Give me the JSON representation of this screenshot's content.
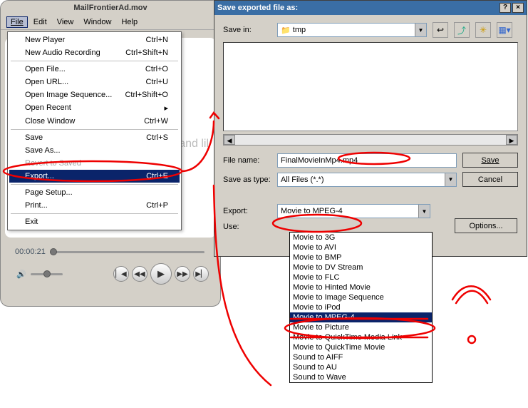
{
  "player": {
    "title": "MailFrontierAd.mov",
    "menubar": [
      "File",
      "Edit",
      "View",
      "Window",
      "Help"
    ],
    "file_menu": {
      "groups": [
        [
          {
            "label": "New Player",
            "shortcut": "Ctrl+N",
            "disabled": false
          },
          {
            "label": "New Audio Recording",
            "shortcut": "Ctrl+Shift+N",
            "disabled": false
          }
        ],
        [
          {
            "label": "Open File...",
            "shortcut": "Ctrl+O",
            "disabled": false
          },
          {
            "label": "Open URL...",
            "shortcut": "Ctrl+U",
            "disabled": false
          },
          {
            "label": "Open Image Sequence...",
            "shortcut": "Ctrl+Shift+O",
            "disabled": false
          },
          {
            "label": "Open Recent",
            "shortcut": "▸",
            "disabled": false
          },
          {
            "label": "Close Window",
            "shortcut": "Ctrl+W",
            "disabled": false
          }
        ],
        [
          {
            "label": "Save",
            "shortcut": "Ctrl+S",
            "disabled": false
          },
          {
            "label": "Save As...",
            "shortcut": "",
            "disabled": false
          },
          {
            "label": "Revert to Saved",
            "shortcut": "",
            "disabled": true
          },
          {
            "label": "Export...",
            "shortcut": "Ctrl+E",
            "disabled": false,
            "highlight": true
          }
        ],
        [
          {
            "label": "Page Setup...",
            "shortcut": "",
            "disabled": false
          },
          {
            "label": "Print...",
            "shortcut": "Ctrl+P",
            "disabled": false
          }
        ],
        [
          {
            "label": "Exit",
            "shortcut": "",
            "disabled": false
          }
        ]
      ]
    },
    "video_bg_text": "and lil",
    "timecode": "00:00:21"
  },
  "dialog": {
    "title": "Save exported file as:",
    "help": "?",
    "close": "×",
    "save_in_label": "Save in:",
    "save_in_value": "tmp",
    "nav_icons": [
      "back",
      "up",
      "new-folder",
      "views"
    ],
    "file_name_label": "File name:",
    "file_name_value": "FinalMovieInMp4.mp4",
    "save_as_type_label": "Save as type:",
    "save_as_type_value": "All Files (*.*)",
    "save_btn": "Save",
    "cancel_btn": "Cancel",
    "export_label": "Export:",
    "export_value": "Movie to MPEG-4",
    "use_label": "Use:",
    "options_btn": "Options...",
    "export_options": [
      "Movie to 3G",
      "Movie to AVI",
      "Movie to BMP",
      "Movie to DV Stream",
      "Movie to FLC",
      "Movie to Hinted Movie",
      "Movie to Image Sequence",
      "Movie to iPod",
      "Movie to MPEG-4",
      "Movie to Picture",
      "Movie to QuickTime Media Link",
      "Movie to QuickTime Movie",
      "Sound to AIFF",
      "Sound to AU",
      "Sound to Wave"
    ],
    "export_selected_index": 8
  }
}
